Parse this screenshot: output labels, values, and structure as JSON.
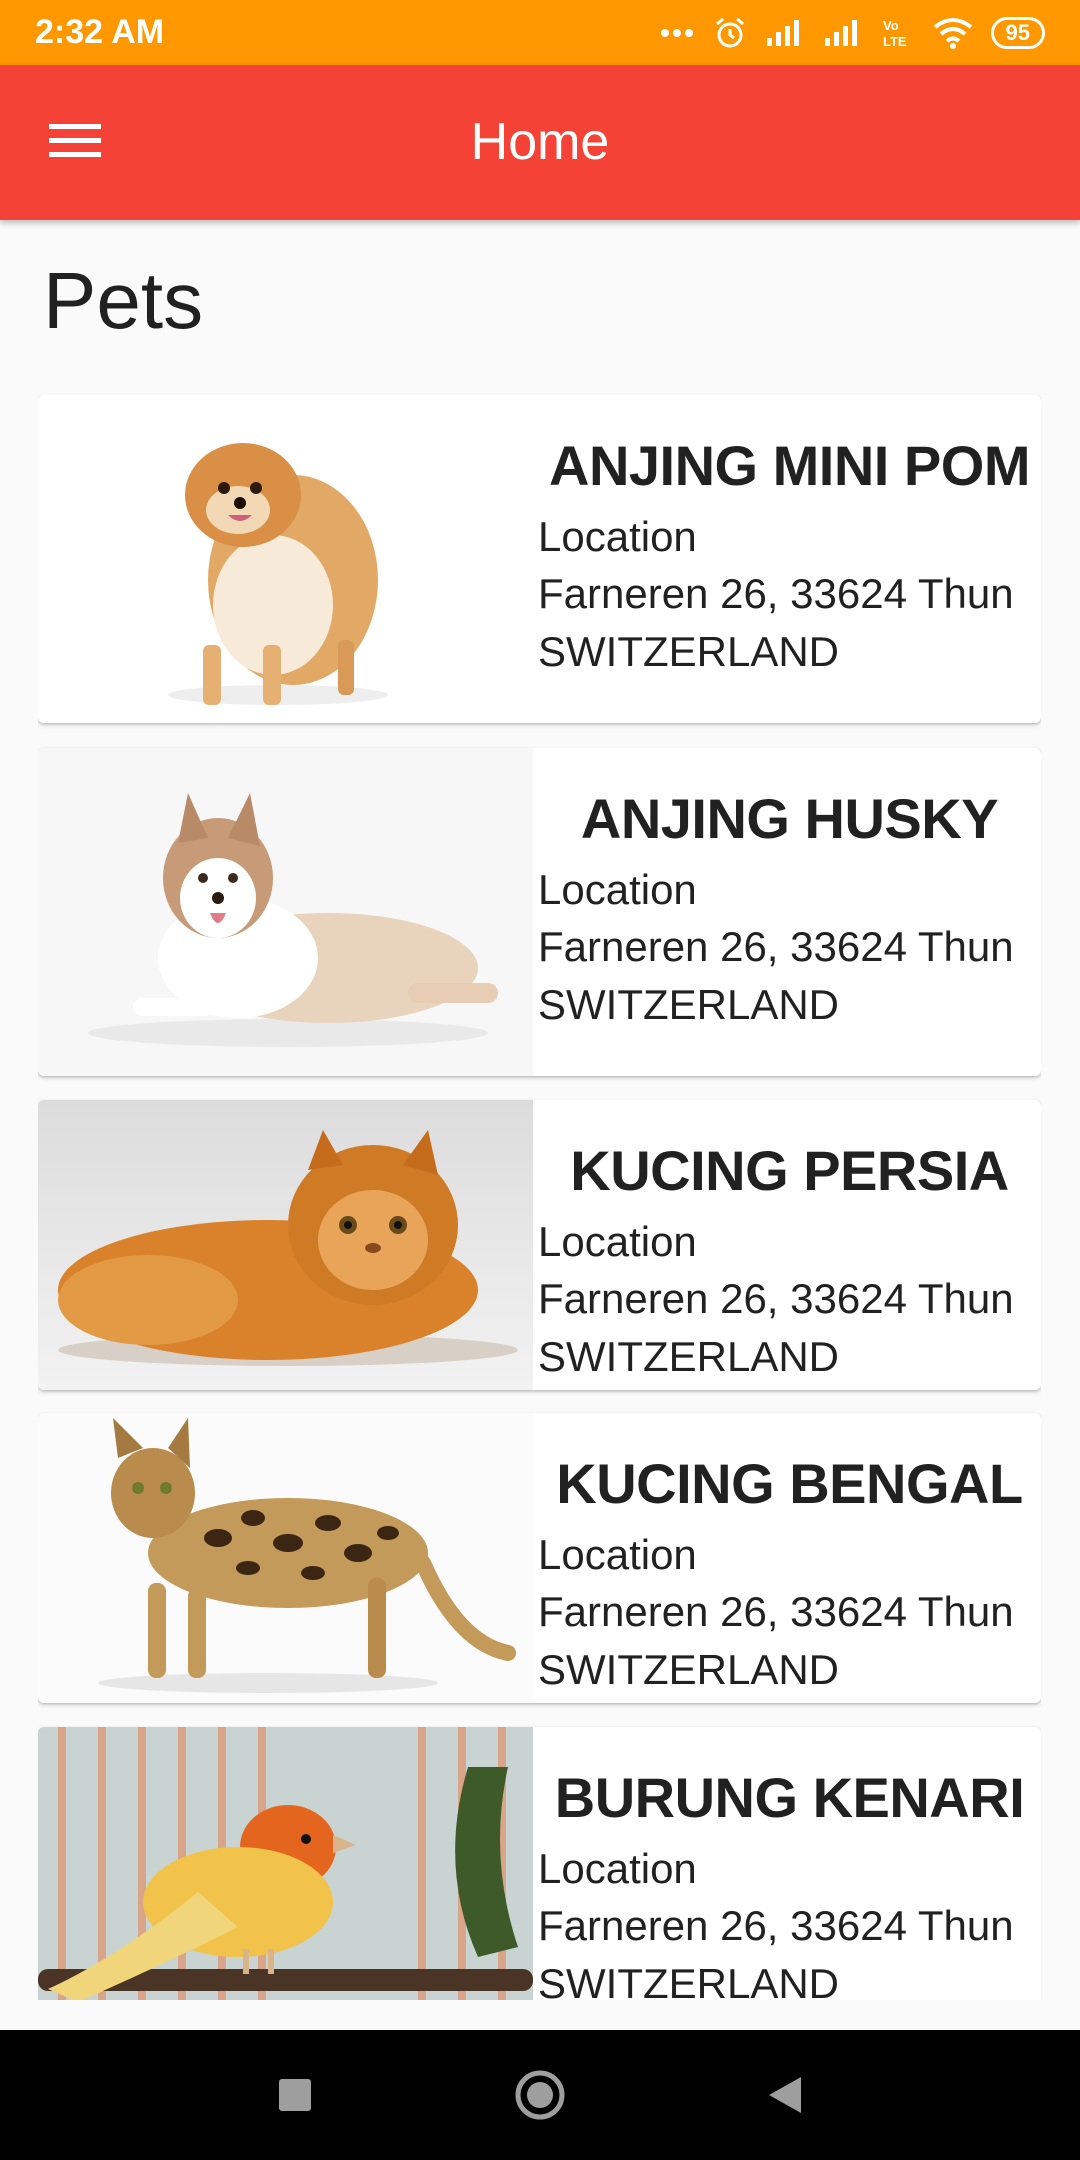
{
  "status_bar": {
    "time": "2:32 AM",
    "battery": "95",
    "icons": [
      "more-dots-icon",
      "alarm-icon",
      "signal-icon",
      "signal-icon",
      "volte-icon",
      "wifi-icon",
      "battery-icon"
    ]
  },
  "app_bar": {
    "title": "Home",
    "menu_icon": "hamburger-menu-icon"
  },
  "page": {
    "title": "Pets"
  },
  "pets": [
    {
      "name": "ANJING MINI POM",
      "location_label": "Location",
      "address": "Farneren 26, 33624 Thun",
      "country": "SWITZERLAND",
      "image": "pomeranian-photo"
    },
    {
      "name": "ANJING HUSKY",
      "location_label": "Location",
      "address": "Farneren 26, 33624 Thun",
      "country": "SWITZERLAND",
      "image": "husky-photo"
    },
    {
      "name": "KUCING PERSIA",
      "location_label": "Location",
      "address": "Farneren 26, 33624 Thun",
      "country": "SWITZERLAND",
      "image": "persian-cat-photo"
    },
    {
      "name": "KUCING BENGAL",
      "location_label": "Location",
      "address": "Farneren 26, 33624 Thun",
      "country": "SWITZERLAND",
      "image": "bengal-cat-photo"
    },
    {
      "name": "BURUNG KENARI",
      "location_label": "Location",
      "address": "Farneren 26, 33624 Thun",
      "country": "SWITZERLAND",
      "image": "canary-photo"
    }
  ],
  "nav_bar": {
    "buttons": [
      "recents-square-icon",
      "home-circle-icon",
      "back-triangle-icon"
    ]
  },
  "colors": {
    "status_bar": "#ff9800",
    "app_bar": "#f44336",
    "background": "#fafafa",
    "card": "#ffffff",
    "text": "#212121"
  }
}
